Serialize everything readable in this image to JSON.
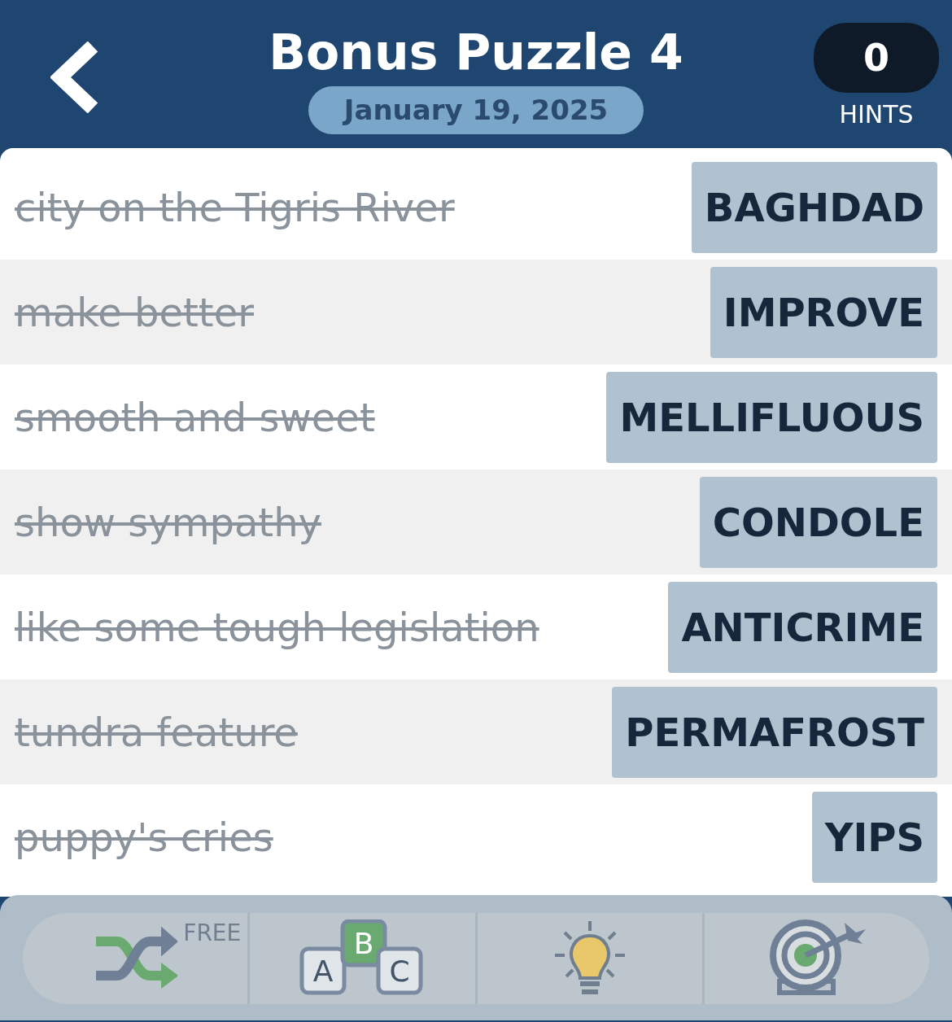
{
  "header": {
    "title": "Bonus Puzzle 4",
    "date": "January 19, 2025",
    "hints": {
      "count": "0",
      "label": "HINTS"
    }
  },
  "clues": [
    {
      "clue": "city on the Tigris River",
      "answer": "BAGHDAD",
      "solved": true
    },
    {
      "clue": "make better",
      "answer": "IMPROVE",
      "solved": true
    },
    {
      "clue": "smooth and sweet",
      "answer": "MELLIFLUOUS",
      "solved": true
    },
    {
      "clue": "show sympathy",
      "answer": "CONDOLE",
      "solved": true
    },
    {
      "clue": "like some tough legislation",
      "answer": "ANTICRIME",
      "solved": true
    },
    {
      "clue": "tundra feature",
      "answer": "PERMAFROST",
      "solved": true
    },
    {
      "clue": "puppy's cries",
      "answer": "YIPS",
      "solved": true
    }
  ],
  "toolbar": [
    {
      "kind": "shuffle",
      "badge": "FREE"
    },
    {
      "kind": "letters",
      "letters": [
        "A",
        "B",
        "C"
      ]
    },
    {
      "kind": "hint"
    },
    {
      "kind": "target"
    }
  ]
}
